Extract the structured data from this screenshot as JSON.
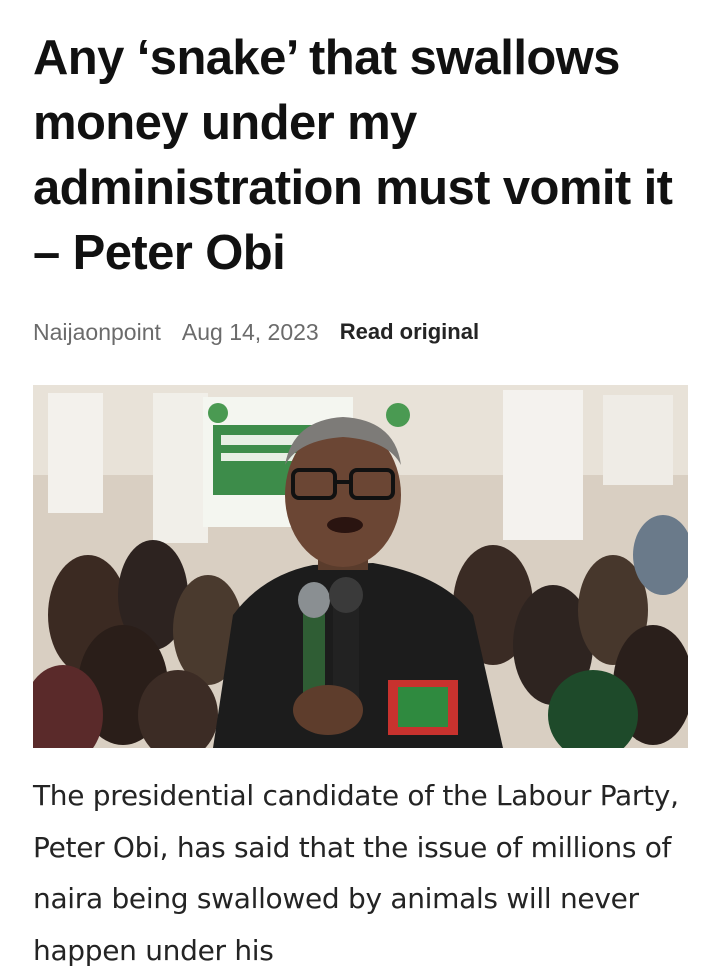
{
  "article": {
    "headline": "Any ‘snake’ that swallows money under my administration must vomit it – Peter Obi",
    "source": "Naijaonpoint",
    "date": "Aug 14, 2023",
    "read_original_label": "Read original",
    "image_alt": "Peter Obi speaking into microphones in front of a crowd",
    "body": "The presidential candidate of the Labour Party, Peter Obi, has said that the issue of millions of naira being swallowed by animals will never happen under his"
  },
  "colors": {
    "headline": "#111111",
    "meta": "#6b6b6b",
    "read_original": "#242424",
    "body": "#242424"
  }
}
